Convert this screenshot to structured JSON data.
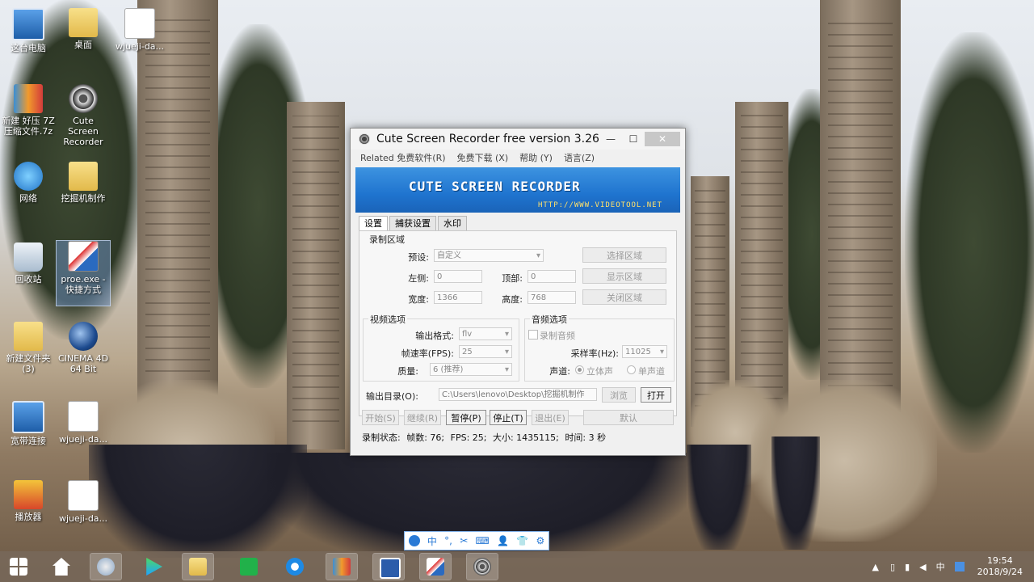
{
  "desktop": {
    "icons": [
      {
        "label": "这台电脑"
      },
      {
        "label": "桌面"
      },
      {
        "label": "wjueji-da..."
      },
      {
        "label": "新建 好压 7Z 压缩文件.7z"
      },
      {
        "label": "Cute Screen Recorder"
      },
      {
        "label": "网络"
      },
      {
        "label": "挖掘机制作"
      },
      {
        "label": "回收站"
      },
      {
        "label": "proe.exe - 快捷方式"
      },
      {
        "label": "新建文件夹 (3)"
      },
      {
        "label": "CINEMA 4D 64 Bit"
      },
      {
        "label": "宽带连接"
      },
      {
        "label": "wjueji-da..."
      },
      {
        "label": "播放器"
      },
      {
        "label": "wjueji-da..."
      }
    ]
  },
  "window": {
    "title": "Cute Screen Recorder free version 3.26...",
    "controls": {
      "minimize": "—",
      "maximize": "☐",
      "close": "✕"
    },
    "menu": [
      "Related 免费软件(R)",
      "免费下载 (X)",
      "帮助 (Y)",
      "语言(Z)"
    ],
    "banner": {
      "title": "CUTE SCREEN RECORDER",
      "url": "HTTP://WWW.VIDEOTOOL.NET"
    },
    "tabs": [
      "设置",
      "捕获设置",
      "水印"
    ],
    "record_area": {
      "group_label": "录制区域",
      "preset_label": "预设:",
      "preset_value": "自定义",
      "left_label": "左侧:",
      "left_value": "0",
      "top_label": "顶部:",
      "top_value": "0",
      "width_label": "宽度:",
      "width_value": "1366",
      "height_label": "高度:",
      "height_value": "768",
      "select_btn": "选择区域",
      "show_btn": "显示区域",
      "close_btn": "关闭区域"
    },
    "video": {
      "group_label": "视频选项",
      "format_label": "输出格式:",
      "format_value": "flv",
      "fps_label": "帧速率(FPS):",
      "fps_value": "25",
      "quality_label": "质量:",
      "quality_value": "6 (推荐)"
    },
    "audio": {
      "group_label": "音频选项",
      "record_label": "录制音频",
      "samplerate_label": "采样率(Hz):",
      "samplerate_value": "11025",
      "channel_label": "声道:",
      "stereo_label": "立体声",
      "mono_label": "单声道"
    },
    "output": {
      "label": "输出目录(O):",
      "path": "C:\\Users\\lenovo\\Desktop\\挖掘机制作",
      "browse_btn": "浏览",
      "open_btn": "打开"
    },
    "actions": {
      "start": "开始(S)",
      "resume": "继续(R)",
      "pause": "暂停(P)",
      "stop": "停止(T)",
      "exit": "退出(E)",
      "default": "默认"
    },
    "status": {
      "label": "录制状态:",
      "frames": "帧数: 76;",
      "fps": "FPS: 25;",
      "size": "大小: 1435115;",
      "time": "时间: 3 秒"
    }
  },
  "ime": {
    "items": [
      "中",
      "°,",
      "✂",
      "⌨",
      "👤",
      "👕",
      "⚙"
    ]
  },
  "taskbar": {
    "clock_time": "19:54",
    "clock_date": "2018/9/24",
    "ime_indicator": "中"
  }
}
